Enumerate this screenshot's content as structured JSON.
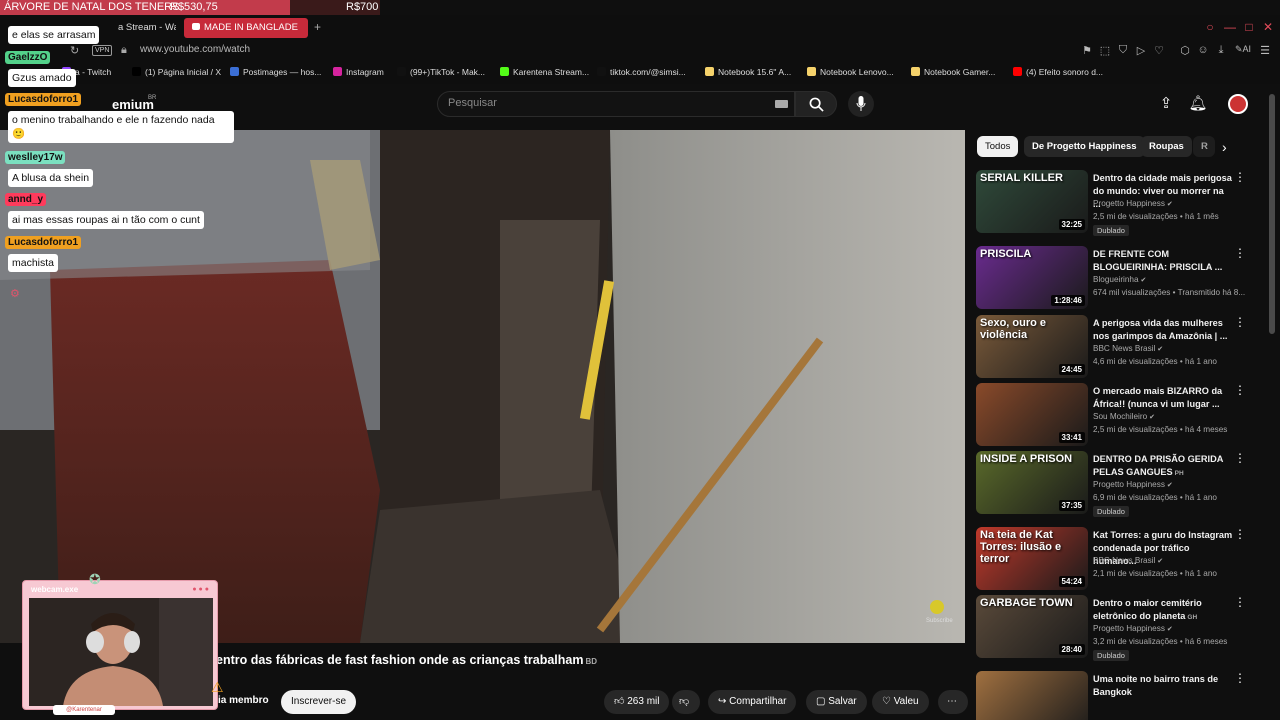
{
  "donation": {
    "title": "ÁRVORE DE NATAL DOS TENERS",
    "current": "R$530,75",
    "goal": "R$700"
  },
  "browser": {
    "tabs": [
      {
        "label": "a Stream - Watc"
      },
      {
        "label": "MADE IN BANGLADE",
        "active": true
      }
    ],
    "vpn": "VPN",
    "url": "www.youtube.com/watch",
    "bookmarks": [
      {
        "label": "a - Twitch",
        "color": "#9146ff"
      },
      {
        "label": "(1) Página Inicial / X",
        "color": "#000000"
      },
      {
        "label": "Postimages — hos...",
        "color": "#3b6fd6"
      },
      {
        "label": "Instagram",
        "color": "#d6249f"
      },
      {
        "label": "(99+)TikTok - Mak...",
        "color": "#111111"
      },
      {
        "label": "Karentena Stream...",
        "color": "#53fc18"
      },
      {
        "label": "tiktok.com/@simsi...",
        "color": "#111111"
      },
      {
        "label": "Notebook 15.6'' A...",
        "color": "#f5d26b"
      },
      {
        "label": "Notebook Lenovo...",
        "color": "#f5d26b"
      },
      {
        "label": "Notebook Gamer...",
        "color": "#f5d26b"
      },
      {
        "label": "(4) Efeito sonoro d...",
        "color": "#ff0000"
      }
    ]
  },
  "youtube": {
    "logo_text": "emium",
    "logo_region": "BR",
    "search_placeholder": "Pesquisar",
    "video_title": "entro das fábricas de fast fashion onde as crianças trabalham",
    "video_title_suffix": "BD",
    "join_label": "ia membro",
    "subscribe_label": "Inscrever-se",
    "likes": "263 mil",
    "share_label": "Compartilhar",
    "save_label": "Salvar",
    "thanks_label": "Valeu",
    "subscribe_watermark": "Subscribe"
  },
  "chips": [
    {
      "label": "Todos",
      "active": true
    },
    {
      "label": "De Progetto Happiness"
    },
    {
      "label": "Roupas"
    },
    {
      "label": "R"
    }
  ],
  "recommended": [
    {
      "title": "Dentro da cidade mais perigosa do mundo: viver ou morrer na ...",
      "channel": "Progetto Happiness",
      "meta": "2,5 mi de visualizações • há 1 mês",
      "duration": "32:25",
      "badge": "Dublado",
      "thumb_text": "SERIAL    KILLER",
      "thumb_color": "#2f4a3a"
    },
    {
      "title": "DE FRENTE COM BLOGUEIRINHA: PRISCILA ...",
      "channel": "Blogueirinha",
      "meta": "674 mil visualizações • Transmitido há 8...",
      "duration": "1:28:46",
      "badge": "",
      "thumb_text": "PRISCILA",
      "thumb_color": "#6a2b8f"
    },
    {
      "title": "A perigosa vida das mulheres nos garimpos da Amazônia | ...",
      "channel": "BBC News Brasil",
      "meta": "4,6 mi de visualizações • há 1 ano",
      "duration": "24:45",
      "badge": "",
      "thumb_text": "Sexo, ouro e violência",
      "thumb_color": "#7a5a3a"
    },
    {
      "title": "O mercado mais BIZARRO da África!! (nunca vi um lugar ...",
      "channel": "Sou Mochileiro",
      "meta": "2,5 mi de visualizações • há 4 meses",
      "duration": "33:41",
      "badge": "",
      "thumb_text": "",
      "thumb_color": "#8a4a2a"
    },
    {
      "title": "DENTRO DA PRISÃO GERIDA PELAS GANGUES",
      "title_suffix": "PH",
      "channel": "Progetto Happiness",
      "meta": "6,9 mi de visualizações • há 1 ano",
      "duration": "37:35",
      "badge": "Dublado",
      "thumb_text": "INSIDE A PRISON",
      "thumb_color": "#5a6a2a"
    },
    {
      "title": "Kat Torres: a guru do Instagram condenada por tráfico humano...",
      "channel": "BBC News Brasil",
      "meta": "2,1 mi de visualizações • há 1 ano",
      "duration": "54:24",
      "badge": "",
      "thumb_text": "Na teia de Kat Torres: ilusão e terror",
      "thumb_color": "#c0392b"
    },
    {
      "title": "Dentro o maior cemitério eletrônico do planeta",
      "title_suffix": "GH",
      "channel": "Progetto Happiness",
      "meta": "3,2 mi de visualizações • há 6 meses",
      "duration": "28:40",
      "badge": "Dublado",
      "thumb_text": "GARBAGE TOWN",
      "thumb_color": "#5a4a3a"
    },
    {
      "title": "Uma noite no bairro trans de Bangkok",
      "channel": "",
      "meta": "",
      "duration": "",
      "badge": "",
      "thumb_text": "",
      "thumb_color": "#a07040"
    }
  ],
  "chat": [
    {
      "name": "",
      "message": "e elas se arrasam",
      "name_color": "#ff5a6e"
    },
    {
      "name": "GaelzzO",
      "message": "Gzus amado",
      "name_color": "#53d18a"
    },
    {
      "name": "Lucasdoforro1",
      "message": "o menino trabalhando e ele n fazendo nada 🙂",
      "name_color": "#f0a020"
    },
    {
      "name": "weslley17w",
      "message": "A blusa da shein",
      "name_color": "#7be0c0"
    },
    {
      "name": "annd_y",
      "message": "ai mas essas roupas ai n tão com o cunt",
      "name_color": "#ff3b5c"
    },
    {
      "name": "Lucasdoforro1",
      "message": "machista",
      "name_color": "#f0a020"
    }
  ],
  "webcam": {
    "title": "webcam.exe",
    "handle": "@Karentenar"
  }
}
